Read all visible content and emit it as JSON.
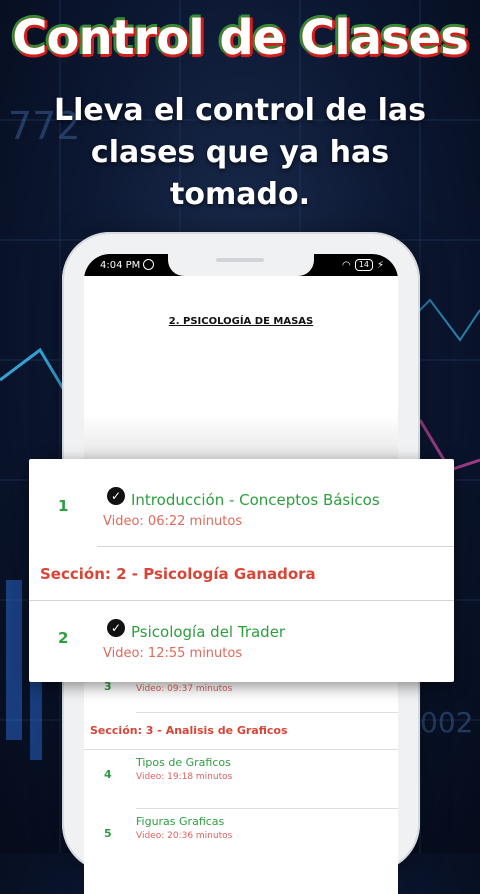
{
  "hero": {
    "title": "Control de Clases",
    "subtitle": "Lleva el control de las clases que ya has tomado."
  },
  "status_bar": {
    "time": "4:04 PM",
    "battery": "14"
  },
  "document": {
    "heading": "2. PSICOLOGÍA DE MASAS"
  },
  "featured_list": {
    "items": [
      {
        "number": "1",
        "title": "Introducción - Conceptos Básicos",
        "duration": "Video: 06:22 minutos",
        "completed": true
      },
      {
        "number": "2",
        "title": "Psicología del Trader",
        "duration": "Video: 12:55 minutos",
        "completed": true
      }
    ],
    "section_label": "Sección: 2 - Psicología Ganadora"
  },
  "background_list": {
    "partial_item": {
      "number": "3",
      "duration": "Video: 09:37 minutos"
    },
    "section_label": "Sección: 3 - Analisis de Graficos",
    "items": [
      {
        "number": "4",
        "title": "Tipos de Graficos",
        "duration": "Video: 19:18 minutos"
      },
      {
        "number": "5",
        "title": "Figuras Graficas",
        "duration": "Video: 20:36 minutos"
      }
    ]
  },
  "background_numbers": {
    "left": "772",
    "right": "002"
  },
  "colors": {
    "accent_green": "#2e9e3f",
    "section_red": "#d84536",
    "duration_red": "#e06a5c",
    "title_red_outline": "#d3201e",
    "title_green_outline": "#1e9e3a"
  }
}
